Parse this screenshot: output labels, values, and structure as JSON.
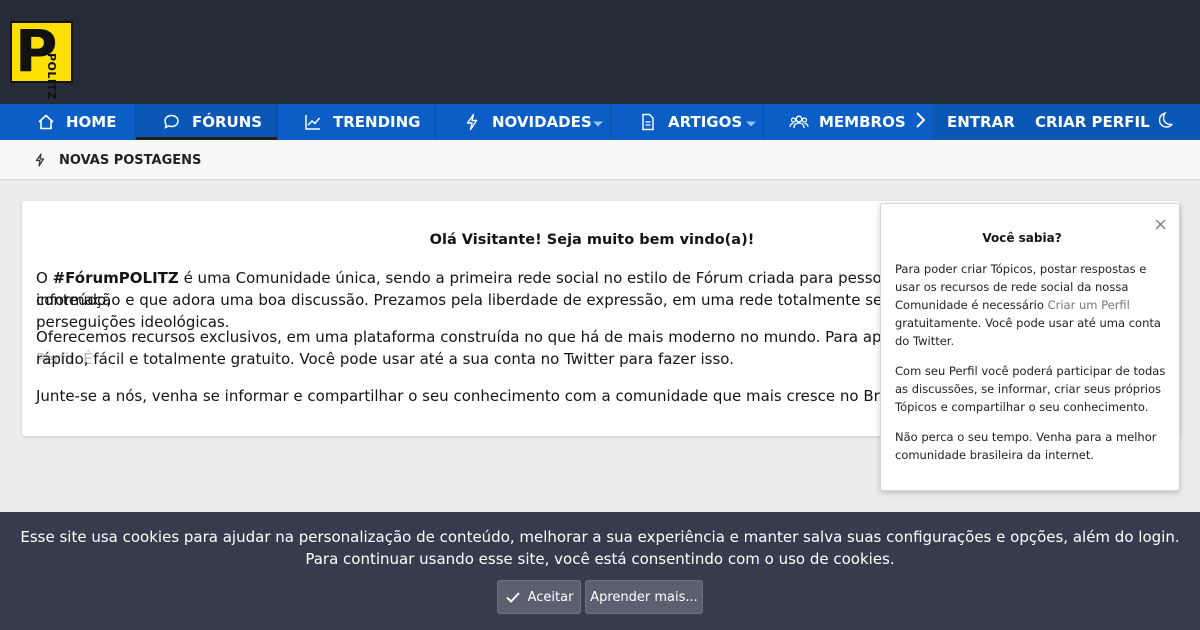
{
  "header": {
    "logo_letter": "P",
    "logo_word": "POLITZ"
  },
  "nav": {
    "home": "HOME",
    "foruns": "FÓRUNS",
    "trending": "TRENDING",
    "novidades": "NOVIDADES",
    "artigos": "ARTIGOS",
    "membros": "MEMBROS",
    "entrar": "ENTRAR",
    "criar_perfil": "CRIAR PERFIL"
  },
  "subnav": {
    "novas_postagens": "NOVAS POSTAGENS"
  },
  "welcome": {
    "title": "Olá Visitante! Seja muito bem vindo(a)!",
    "p1_start": "O ",
    "p1_brand": "#FórumPOLITZ",
    "p1_rest": " é uma Comunidade única, sendo a primeira rede social no estilo de Fórum criada para pessoas que tem sede de conhecimento, conteúdo,",
    "p1_line2": "informação e que adora uma boa discussão. Prezamos pela liberdade de expressão, em uma rede totalmente segura, livre de censuras e perseguições ideológicas.",
    "p2_line1": "Oferecemos recursos exclusivos, em uma plataforma construída no que há de mais moderno no mundo. Para aproveitar tudo isso é preciso ",
    "p2_link": "Criar um Perfil",
    "p2_after": ". É",
    "p2_line2": "rápido, fácil e totalmente gratuito. Você pode usar até a sua conta no Twitter para fazer isso.",
    "p3": "Junte-se a nós, venha se informar e compartilhar o seu conhecimento com a comunidade que mais cresce no Brasil. Esperamos que goste :)"
  },
  "popup": {
    "title": "Você sabia?",
    "close": "×",
    "text1": "Para poder criar Tópicos, postar respostas e usar os recursos de rede social da nossa Comunidade é necessário ",
    "text1_link": "Criar um Perfil",
    "text1_end": " gratuitamente. Você pode usar até uma conta do Twitter.",
    "text2": "Com seu Perfil você poderá participar de todas as discussões, se informar, criar seus próprios Tópicos e compartilhar o seu conhecimento.",
    "text3": "Não perca o seu tempo. Venha para a melhor comunidade brasileira da internet."
  },
  "cookie": {
    "line1": "Esse site usa cookies para ajudar na personalização de conteúdo, melhorar a sua experiência e manter salva suas configurações e opções, além do login.",
    "line2": "Para continuar usando esse site, você está consentindo com o uso de cookies.",
    "accept": "Aceitar",
    "learn_more": "Aprender mais..."
  },
  "colors": {
    "header_bg": "#262b38",
    "nav_bg": "#0a5ec6",
    "logo_yellow": "#fde000",
    "cookie_bg": "#353c4d"
  }
}
